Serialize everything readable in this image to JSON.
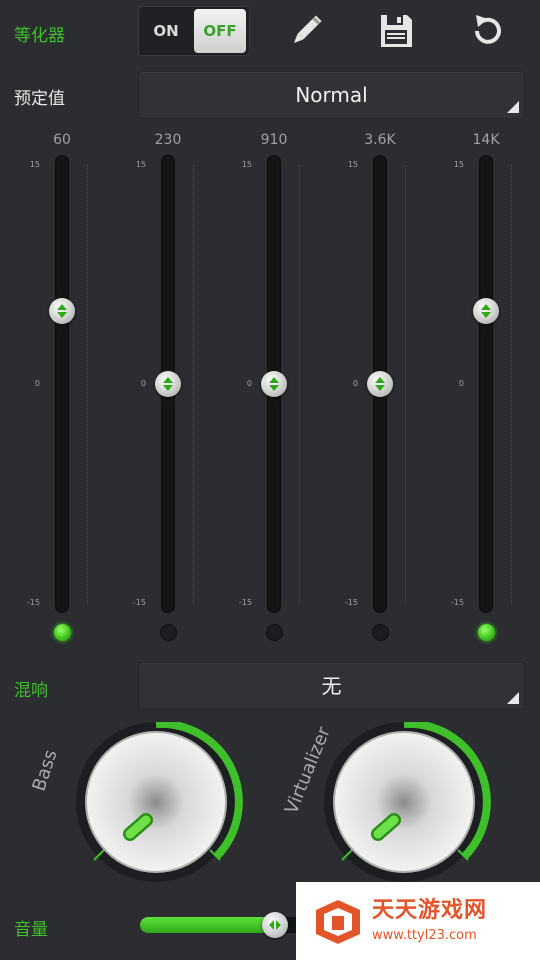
{
  "header": {
    "equalizer_label": "等化器",
    "toggle": {
      "on_label": "ON",
      "off_label": "OFF",
      "selected": "OFF"
    },
    "icons": [
      "pencil-icon",
      "save-icon",
      "reset-icon"
    ]
  },
  "preset": {
    "label": "预定值",
    "value": "Normal"
  },
  "equalizer": {
    "scale": {
      "max": "15",
      "mid": "0",
      "min": "-15"
    },
    "bands": [
      {
        "freq": "60",
        "value": 5,
        "active": true
      },
      {
        "freq": "230",
        "value": 0,
        "active": false
      },
      {
        "freq": "910",
        "value": 0,
        "active": false
      },
      {
        "freq": "3.6K",
        "value": 0,
        "active": false
      },
      {
        "freq": "14K",
        "value": 5,
        "active": true
      }
    ]
  },
  "reverb": {
    "label": "混响",
    "value": "无"
  },
  "effects": {
    "bass": {
      "label": "Bass"
    },
    "virtualizer": {
      "label": "Virtualizer"
    }
  },
  "volume": {
    "label": "音量",
    "level": 0.5
  },
  "watermark": {
    "title": "天天游戏网",
    "url": "www.ttyl23.com"
  },
  "colors": {
    "accent": "#3fbf2a",
    "background": "#2b2d31"
  }
}
